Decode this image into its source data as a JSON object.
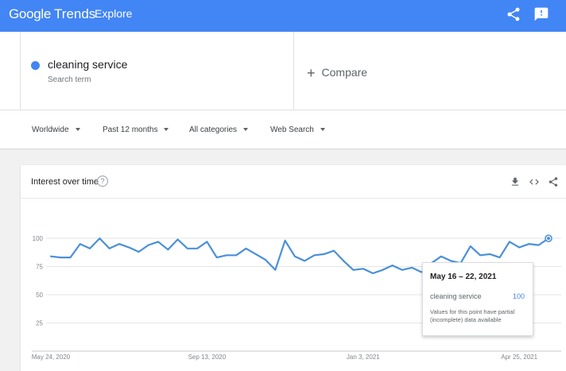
{
  "header": {
    "brand_google": "Google",
    "brand_trends": "Trends",
    "nav_label": "Explore",
    "icons": [
      "share-icon",
      "feedback-icon"
    ]
  },
  "search": {
    "term": "cleaning service",
    "term_type": "Search term",
    "term_color": "#4285f4",
    "compare_plus": "+",
    "compare_label": "Compare"
  },
  "filters": [
    {
      "label": "Worldwide"
    },
    {
      "label": "Past 12 months"
    },
    {
      "label": "All categories"
    },
    {
      "label": "Web Search"
    }
  ],
  "card": {
    "title": "Interest over time",
    "help_glyph": "?",
    "icons": [
      "download-icon",
      "embed-icon",
      "share-icon"
    ]
  },
  "chart_data": {
    "type": "line",
    "y_ticks": [
      "100",
      "75",
      "50",
      "25"
    ],
    "y_tick_values": [
      100,
      75,
      50,
      25
    ],
    "ylim": [
      0,
      100
    ],
    "x_labels": [
      "May 24, 2020",
      "Sep 13, 2020",
      "Jan 3, 2021",
      "Apr 25, 2021"
    ],
    "x_label_indices": [
      0,
      16,
      32,
      48
    ],
    "grid": true,
    "line_color": "#4a90d9",
    "series": [
      {
        "name": "cleaning service",
        "values": [
          84,
          83,
          83,
          95,
          91,
          100,
          91,
          95,
          92,
          88,
          94,
          97,
          90,
          99,
          91,
          91,
          97,
          83,
          85,
          85,
          91,
          86,
          81,
          72,
          98,
          84,
          80,
          85,
          86,
          89,
          80,
          72,
          73,
          69,
          72,
          76,
          72,
          74,
          70,
          78,
          84,
          80,
          78,
          93,
          85,
          86,
          83,
          97,
          92,
          95,
          94,
          100
        ]
      }
    ],
    "highlight_index": 51
  },
  "tooltip": {
    "date": "May 16 – 22, 2021",
    "term": "cleaning service",
    "value": "100",
    "note": "Values for this point have partial (incomplete) data available"
  }
}
